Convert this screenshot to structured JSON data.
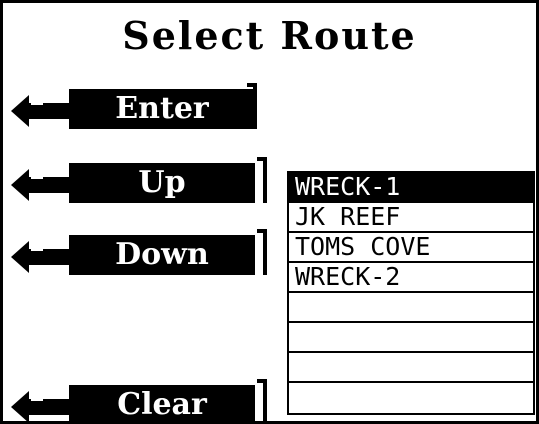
{
  "screen": {
    "title": "Select Route"
  },
  "softkeys": [
    {
      "label": "Enter"
    },
    {
      "label": "Up"
    },
    {
      "label": "Down"
    },
    {
      "label": "Clear"
    }
  ],
  "routes": [
    {
      "name": "WRECK-1",
      "selected": true
    },
    {
      "name": "JK REEF",
      "selected": false
    },
    {
      "name": "TOMS COVE",
      "selected": false
    },
    {
      "name": "WRECK-2",
      "selected": false
    },
    {
      "name": "",
      "selected": false
    },
    {
      "name": "",
      "selected": false
    },
    {
      "name": "",
      "selected": false
    },
    {
      "name": "",
      "selected": false
    }
  ],
  "colors": {
    "foreground": "#000000",
    "background": "#ffffff",
    "selection": "#000000"
  },
  "icons": {
    "softkey_arrow": "left-return-arrow-icon"
  }
}
